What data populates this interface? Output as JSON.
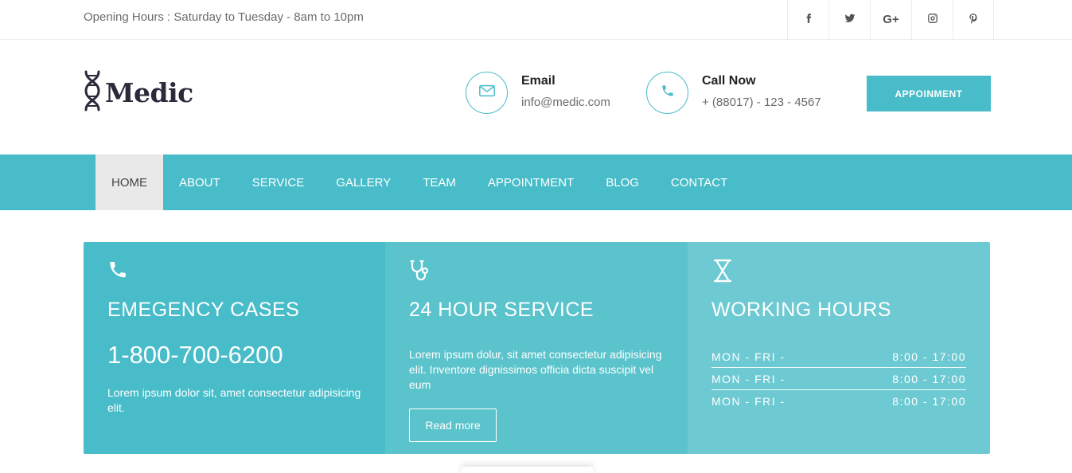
{
  "topbar": {
    "opening_hours": "Opening Hours : Saturday to Tuesday - 8am to 10pm",
    "social": [
      {
        "icon": "facebook-icon",
        "glyph": "f"
      },
      {
        "icon": "twitter-icon",
        "glyph": ""
      },
      {
        "icon": "google-plus-icon",
        "glyph": "G+"
      },
      {
        "icon": "instagram-icon",
        "glyph": ""
      },
      {
        "icon": "pinterest-icon",
        "glyph": "P"
      }
    ]
  },
  "header": {
    "brand": "Medic",
    "email": {
      "title": "Email",
      "value": "info@medic.com"
    },
    "call": {
      "title": "Call Now",
      "value": "+ (88017) - 123 - 4567"
    },
    "appointment_button": "APPOINMENT"
  },
  "nav": {
    "items": [
      "HOME",
      "ABOUT",
      "SERVICE",
      "GALLERY",
      "TEAM",
      "APPOINTMENT",
      "BLOG",
      "CONTACT"
    ],
    "active": "HOME"
  },
  "features": {
    "emergency": {
      "title": "EMEGENCY CASES",
      "phone": "1-800-700-6200",
      "desc": "Lorem ipsum dolor sit, amet consectetur adipisicing elit."
    },
    "service": {
      "title": "24 HOUR SERVICE",
      "desc": "Lorem ipsum dolur, sit amet consectetur adipisicing elit. Inventore dignissimos officia dicta suscipit vel eum",
      "button": "Read more"
    },
    "hours": {
      "title": "WORKING HOURS",
      "rows": [
        {
          "day": "MON - FRI -",
          "time": "8:00 - 17:00"
        },
        {
          "day": "MON - FRI -",
          "time": "8:00 - 17:00"
        },
        {
          "day": "MON - FRI -",
          "time": "8:00 - 17:00"
        }
      ]
    }
  },
  "colors": {
    "accent": "#48bcc8",
    "box2": "#5bc3cb",
    "box3": "#6ecad2",
    "nav_active_bg": "#e9e9e9"
  }
}
